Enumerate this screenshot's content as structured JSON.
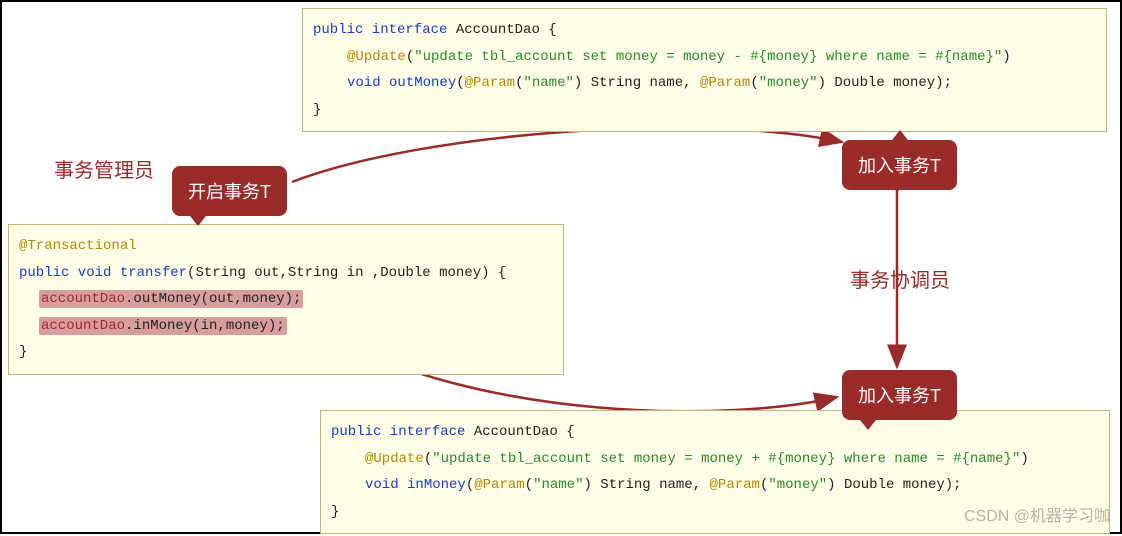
{
  "labels": {
    "manager": "事务管理员",
    "coordinator": "事务协调员"
  },
  "tags": {
    "open": "开启事务T",
    "join1": "加入事务T",
    "join2": "加入事务T"
  },
  "transfer": {
    "annotation": "@Transactional",
    "sig_pre": "public void ",
    "sig_name": "transfer",
    "sig_post": "(String out,String in ,Double money) {",
    "line1_obj": "accountDao",
    "line1_call": ".outMoney(out,money);",
    "line2_obj": "accountDao",
    "line2_call": ".inMoney(in,money);",
    "close": "}"
  },
  "dao_top": {
    "line1_pre": "public interface ",
    "line1_name": "AccountDao {",
    "ann_name": "@Update",
    "ann_open": "(",
    "ann_str": "\"update tbl_account set money = money - #{money} where name = #{name}\"",
    "ann_close": ")",
    "m_ret": "void ",
    "m_name": "outMoney",
    "m_open": "(",
    "p1_ann": "@Param",
    "p1_open": "(",
    "p1_str": "\"name\"",
    "p1_close": ") String name, ",
    "p2_ann": "@Param",
    "p2_open": "(",
    "p2_str": "\"money\"",
    "p2_close": ") Double money);",
    "close": "}"
  },
  "dao_bottom": {
    "line1_pre": "public interface ",
    "line1_name": "AccountDao {",
    "ann_name": "@Update",
    "ann_open": "(",
    "ann_str": "\"update tbl_account set money = money + #{money} where name = #{name}\"",
    "ann_close": ")",
    "m_ret": "void ",
    "m_name": "inMoney",
    "m_open": "(",
    "p1_ann": "@Param",
    "p1_open": "(",
    "p1_str": "\"name\"",
    "p1_close": ") String name, ",
    "p2_ann": "@Param",
    "p2_open": "(",
    "p2_str": "\"money\"",
    "p2_close": ") Double money);",
    "close": "}"
  },
  "watermark": "CSDN @机器学习咖",
  "colors": {
    "boxBg": "#fdfde8",
    "boxBorder": "#c5b36f",
    "tagBg": "#9a2b2b",
    "arrow": "#9a2b2b"
  }
}
